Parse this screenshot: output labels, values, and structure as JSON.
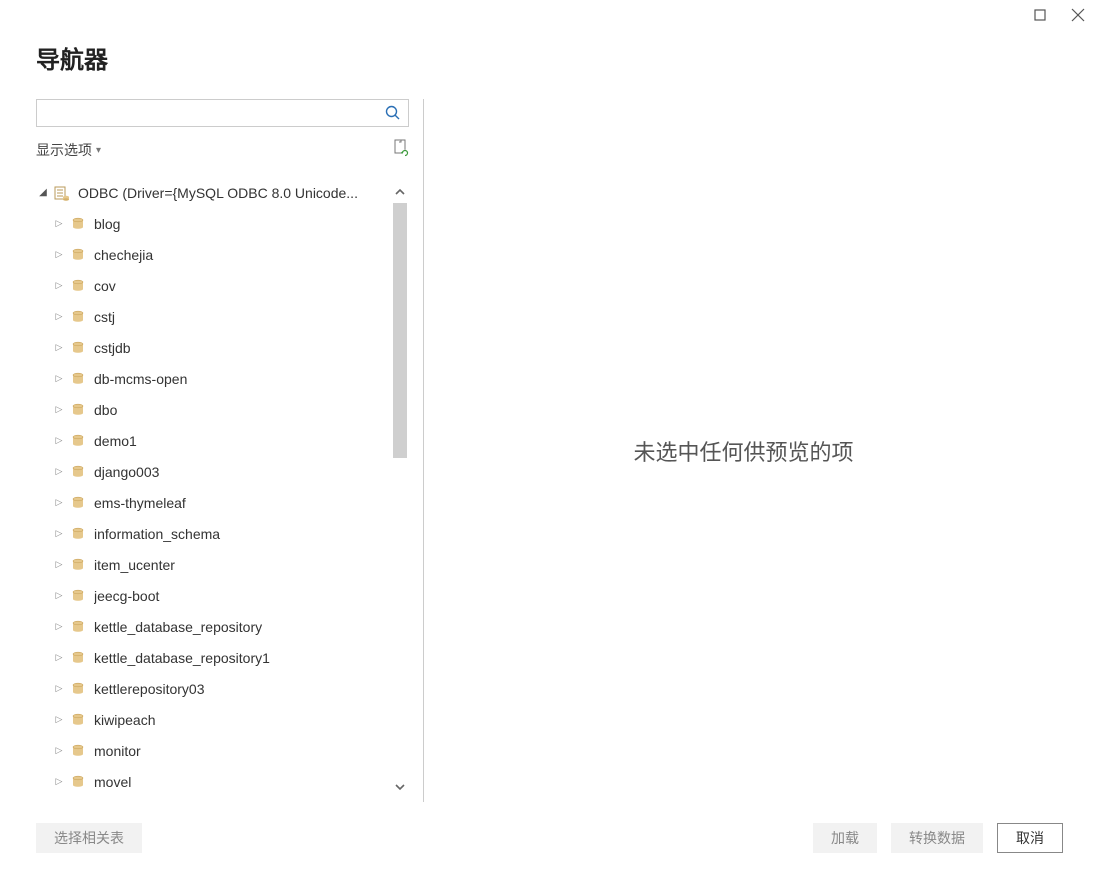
{
  "window": {
    "title": "导航器"
  },
  "search": {
    "placeholder": ""
  },
  "options": {
    "label": "显示选项"
  },
  "tree": {
    "root": {
      "label": "ODBC (Driver={MySQL ODBC 8.0 Unicode..."
    },
    "items": [
      {
        "label": "blog"
      },
      {
        "label": "chechejia"
      },
      {
        "label": "cov"
      },
      {
        "label": "cstj"
      },
      {
        "label": "cstjdb"
      },
      {
        "label": "db-mcms-open"
      },
      {
        "label": "dbo"
      },
      {
        "label": "demo1"
      },
      {
        "label": "django003"
      },
      {
        "label": "ems-thymeleaf"
      },
      {
        "label": "information_schema"
      },
      {
        "label": "item_ucenter"
      },
      {
        "label": "jeecg-boot"
      },
      {
        "label": "kettle_database_repository"
      },
      {
        "label": "kettle_database_repository1"
      },
      {
        "label": "kettlerepository03"
      },
      {
        "label": "kiwipeach"
      },
      {
        "label": "monitor"
      },
      {
        "label": "movel"
      }
    ]
  },
  "preview": {
    "empty": "未选中任何供预览的项"
  },
  "footer": {
    "relatedTables": "选择相关表",
    "load": "加载",
    "transform": "转换数据",
    "cancel": "取消"
  },
  "colors": {
    "folder": "#e6c88c",
    "search": "#2a6fb5"
  }
}
